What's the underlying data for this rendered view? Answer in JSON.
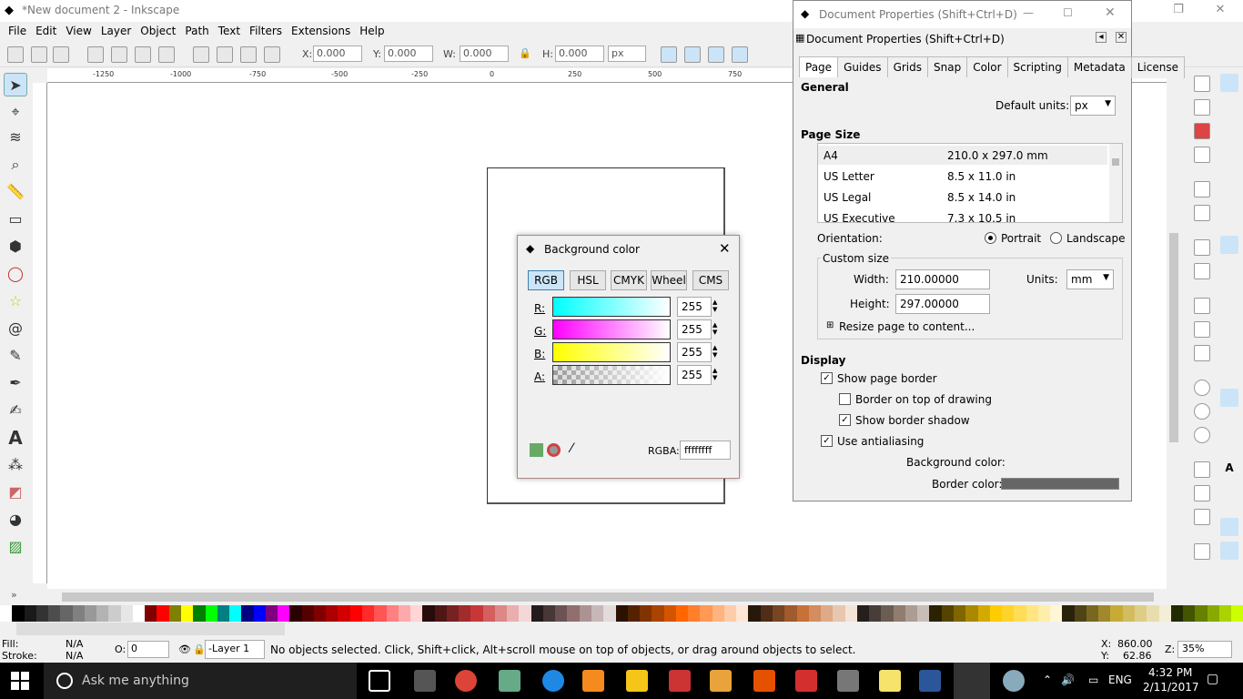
{
  "window": {
    "title": "*New document 2 - Inkscape"
  },
  "menu": [
    "File",
    "Edit",
    "View",
    "Layer",
    "Object",
    "Path",
    "Text",
    "Filters",
    "Extensions",
    "Help"
  ],
  "toolctl": {
    "x_label": "X:",
    "x_value": "0.000",
    "y_label": "Y:",
    "y_value": "0.000",
    "w_label": "W:",
    "w_value": "0.000",
    "h_label": "H:",
    "h_value": "0.000",
    "unit": "px"
  },
  "ruler_ticks": [
    "-1250",
    "-1000",
    "-750",
    "-500",
    "-250",
    "0",
    "250",
    "500",
    "750"
  ],
  "palette": [
    "#ffffff",
    "#000000",
    "#1a1a1a",
    "#333333",
    "#4d4d4d",
    "#666666",
    "#808080",
    "#999999",
    "#b3b3b3",
    "#cccccc",
    "#e6e6e6",
    "#ffffff",
    "#800000",
    "#ff0000",
    "#808000",
    "#ffff00",
    "#008000",
    "#00ff00",
    "#008080",
    "#00ffff",
    "#000080",
    "#0000ff",
    "#800080",
    "#ff00ff",
    "#2b0000",
    "#550000",
    "#800000",
    "#aa0000",
    "#d40000",
    "#ff0000",
    "#ff2a2a",
    "#ff5555",
    "#ff8080",
    "#ffaaaa",
    "#ffd5d5",
    "#280b0b",
    "#501616",
    "#782121",
    "#a02c2c",
    "#c83737",
    "#d35f5f",
    "#de8787",
    "#e9afaf",
    "#f4d7d7",
    "#241c1c",
    "#483737",
    "#6c5353",
    "#916f6f",
    "#ac9393",
    "#c8b7b7",
    "#e3dbdb",
    "#2b1100",
    "#552200",
    "#803300",
    "#aa4400",
    "#d45500",
    "#ff6600",
    "#ff7f2a",
    "#ff9955",
    "#ffb380",
    "#ffccaa",
    "#ffe6d5",
    "#28170b",
    "#502d16",
    "#784421",
    "#a05a2c",
    "#c87137",
    "#d38d5f",
    "#deaa87",
    "#e9c6af",
    "#f4e3d7",
    "#241f1c",
    "#483e37",
    "#6c5d53",
    "#917c6f",
    "#ac9d93",
    "#c8beb7",
    "#2b2200",
    "#554400",
    "#806600",
    "#aa8800",
    "#d4aa00",
    "#ffcc00",
    "#ffd42a",
    "#ffdd55",
    "#ffe680",
    "#ffeeaa",
    "#fff6d5",
    "#28220b",
    "#504416",
    "#786721",
    "#a0892c",
    "#c8ab37",
    "#d3bc5f",
    "#decd87",
    "#e9ddaf",
    "#f4eed7",
    "#222b00",
    "#445500",
    "#668000",
    "#88aa00",
    "#aad400",
    "#ccff00"
  ],
  "status": {
    "fill_label": "Fill:",
    "fill_value": "N/A",
    "stroke_label": "Stroke:",
    "stroke_value": "N/A",
    "opacity_label": "O:",
    "opacity_value": "0",
    "layer": "-Layer 1",
    "message": "No objects selected. Click, Shift+click, Alt+scroll mouse on top of objects, or drag around objects to select.",
    "x_label": "X:",
    "x_value": "860.00",
    "y_label": "Y:",
    "y_value": "62.86",
    "z_label": "Z:",
    "zoom": "35%"
  },
  "taskbar": {
    "search_placeholder": "Ask me anything",
    "lang": "ENG",
    "time": "4:32 PM",
    "date": "2/11/2017"
  },
  "docprops": {
    "window_title": "Document Properties (Shift+Ctrl+D)",
    "panel_title": "Document Properties (Shift+Ctrl+D)",
    "tabs": [
      "Page",
      "Guides",
      "Grids",
      "Snap",
      "Color",
      "Scripting",
      "Metadata",
      "License"
    ],
    "general_label": "General",
    "default_units_label": "Default units:",
    "default_units": "px",
    "page_size_label": "Page Size",
    "sizes": [
      {
        "name": "A4",
        "dims": "210.0 x 297.0 mm"
      },
      {
        "name": "US Letter",
        "dims": "8.5 x 11.0 in"
      },
      {
        "name": "US Legal",
        "dims": "8.5 x 14.0 in"
      },
      {
        "name": "US Executive",
        "dims": "7.3 x 10.5 in"
      }
    ],
    "orientation_label": "Orientation:",
    "portrait": "Portrait",
    "landscape": "Landscape",
    "custom_size_label": "Custom size",
    "width_label": "Width:",
    "width": "210.00000",
    "height_label": "Height:",
    "height": "297.00000",
    "units_label": "Units:",
    "units": "mm",
    "resize_label": "Resize page to content...",
    "display_label": "Display",
    "show_page_border": "Show page border",
    "border_on_top": "Border on top of drawing",
    "show_border_shadow": "Show border shadow",
    "use_antialiasing": "Use antialiasing",
    "background_color_label": "Background color:",
    "border_color_label": "Border color:",
    "border_color": "#666666"
  },
  "bgcolor": {
    "title": "Background color",
    "modes": [
      "RGB",
      "HSL",
      "CMYK",
      "Wheel",
      "CMS"
    ],
    "channels": [
      {
        "label": "R:",
        "value": "255"
      },
      {
        "label": "G:",
        "value": "255"
      },
      {
        "label": "B:",
        "value": "255"
      },
      {
        "label": "A:",
        "value": "255"
      }
    ],
    "rgba_label": "RGBA:",
    "rgba": "ffffffff"
  }
}
